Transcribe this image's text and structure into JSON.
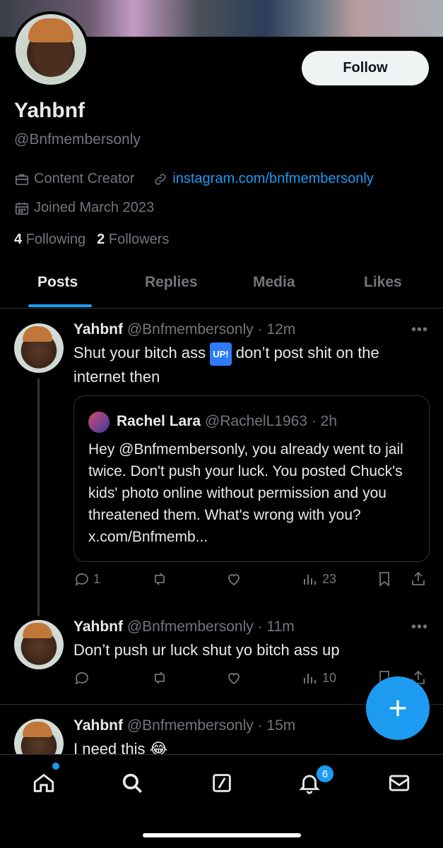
{
  "profile": {
    "name": "Yahbnf",
    "handle": "@Bnfmembersonly",
    "category": "Content Creator",
    "website": "instagram.com/bnfmembersonly",
    "joined": "Joined March 2023",
    "following_count": "4",
    "following_label": "Following",
    "followers_count": "2",
    "followers_label": "Followers",
    "follow_button": "Follow"
  },
  "tabs": [
    {
      "label": "Posts",
      "active": true
    },
    {
      "label": "Replies"
    },
    {
      "label": "Media"
    },
    {
      "label": "Likes"
    }
  ],
  "posts": [
    {
      "author": "Yahbnf",
      "handle": "@Bnfmembersonly",
      "time": "· 12m",
      "text_before": "Shut your bitch ass",
      "emoji_badge": "UP!",
      "text_after": "don’t post shit on the internet then",
      "quote": {
        "author": "Rachel Lara",
        "handle": "@RachelL1963",
        "time": "· 2h",
        "text": "Hey @Bnfmembersonly, you already went to jail twice. Don't push your luck. You posted Chuck's kids' photo online without permission and you threatened them. What's wrong with you? x.com/Bnfmemb..."
      },
      "replies": "1",
      "views": "23"
    },
    {
      "author": "Yahbnf",
      "handle": "@Bnfmembersonly",
      "time": "· 11m",
      "text": "Don’t push ur luck shut yo bitch ass up",
      "views": "10"
    },
    {
      "author": "Yahbnf",
      "handle": "@Bnfmembersonly",
      "time": "· 15m",
      "text": "I need this 😂"
    }
  ],
  "nav": {
    "notification_count": "6"
  },
  "colors": {
    "accent": "#1d9bf0",
    "background": "#000000",
    "muted": "#71767b"
  }
}
